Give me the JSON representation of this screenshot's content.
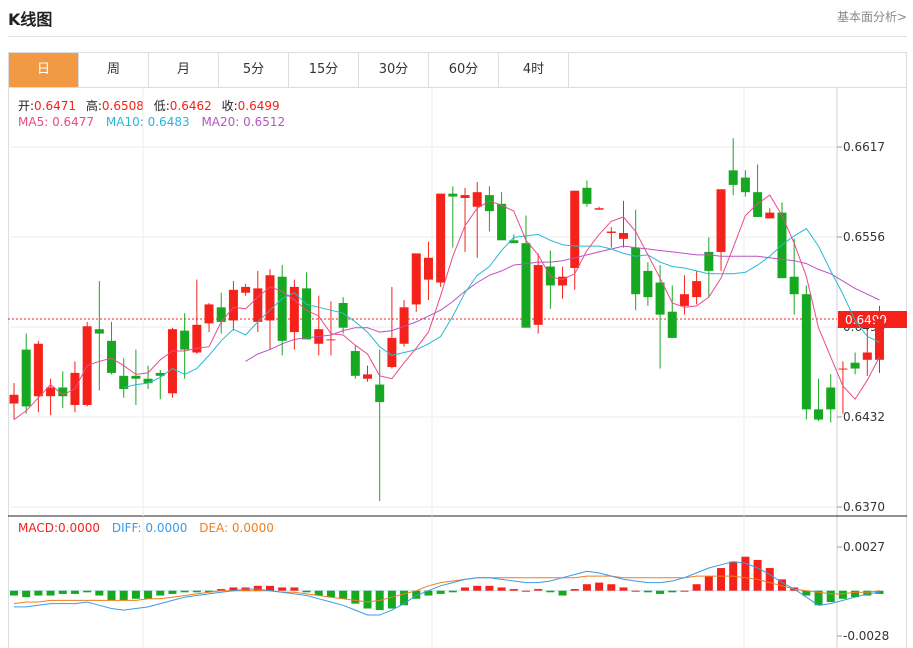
{
  "header": {
    "title": "K线图",
    "link": "基本面分析>"
  },
  "tabs": [
    "日",
    "周",
    "月",
    "5分",
    "15分",
    "30分",
    "60分",
    "4时"
  ],
  "info": {
    "open_label": "开:",
    "open": "0.6471",
    "high_label": "高:",
    "high": "0.6508",
    "low_label": "低:",
    "low": "0.6462",
    "close_label": "收:",
    "close": "0.6499",
    "ma5_label": "MA5:",
    "ma5": "0.6477",
    "ma10_label": "MA10:",
    "ma10": "0.6483",
    "ma20_label": "MA20:",
    "ma20": "0.6512"
  },
  "macd_info": {
    "macd_label": "MACD:",
    "macd": "0.0000",
    "diff_label": "DIFF:",
    "diff": "0.0000",
    "dea_label": "DEA:",
    "dea": "0.0000"
  },
  "colors": {
    "up": "#f5221b",
    "down": "#17a821",
    "ma5": "#e94b8a",
    "ma10": "#27b9d4",
    "ma20": "#b853c4",
    "dea": "#f07f1c",
    "diff": "#3b9ae8",
    "accent": "#f29945"
  },
  "chart_data": [
    {
      "type": "candlestick",
      "title": "",
      "y_ticks": [
        "0.6617",
        "0.6556",
        "0.6494",
        "0.6432",
        "0.6370"
      ],
      "ylim": [
        0.637,
        0.6617
      ],
      "current_price_label": "0.6499",
      "current_price": 0.6499,
      "grid": true,
      "candles": [
        [
          0.6441,
          0.6455,
          0.643,
          0.6447
        ],
        [
          0.6478,
          0.6489,
          0.6434,
          0.6439
        ],
        [
          0.6446,
          0.6484,
          0.6435,
          0.6482
        ],
        [
          0.6446,
          0.6458,
          0.6433,
          0.6452
        ],
        [
          0.6452,
          0.6463,
          0.6438,
          0.6446
        ],
        [
          0.644,
          0.647,
          0.6435,
          0.6462
        ],
        [
          0.644,
          0.6497,
          0.6439,
          0.6494
        ],
        [
          0.6492,
          0.6525,
          0.645,
          0.6489
        ],
        [
          0.6484,
          0.6497,
          0.6461,
          0.6462
        ],
        [
          0.646,
          0.6472,
          0.6445,
          0.6451
        ],
        [
          0.646,
          0.6478,
          0.644,
          0.6458
        ],
        [
          0.6458,
          0.6467,
          0.6451,
          0.6455
        ],
        [
          0.6462,
          0.6464,
          0.6444,
          0.646
        ],
        [
          0.6448,
          0.6493,
          0.6445,
          0.6492
        ],
        [
          0.6491,
          0.6503,
          0.6458,
          0.6478
        ],
        [
          0.6476,
          0.6526,
          0.6475,
          0.6495
        ],
        [
          0.6496,
          0.651,
          0.649,
          0.6509
        ],
        [
          0.6507,
          0.6517,
          0.6489,
          0.6497
        ],
        [
          0.6498,
          0.6525,
          0.6491,
          0.6519
        ],
        [
          0.6517,
          0.6523,
          0.6515,
          0.6521
        ],
        [
          0.6497,
          0.6532,
          0.649,
          0.652
        ],
        [
          0.6498,
          0.6533,
          0.6478,
          0.6529
        ],
        [
          0.6528,
          0.6536,
          0.6474,
          0.6484
        ],
        [
          0.649,
          0.6526,
          0.6478,
          0.6521
        ],
        [
          0.652,
          0.6531,
          0.6489,
          0.6485
        ],
        [
          0.6482,
          0.6515,
          0.6474,
          0.6492
        ],
        [
          0.6485,
          0.6511,
          0.6474,
          0.6485
        ],
        [
          0.651,
          0.6514,
          0.6489,
          0.6493
        ],
        [
          0.6477,
          0.6481,
          0.6458,
          0.646
        ],
        [
          0.6458,
          0.6467,
          0.6456,
          0.6461
        ],
        [
          0.6454,
          0.6478,
          0.6374,
          0.6442
        ],
        [
          0.6466,
          0.6521,
          0.6465,
          0.6486
        ],
        [
          0.6482,
          0.6512,
          0.648,
          0.6507
        ],
        [
          0.6509,
          0.6541,
          0.6504,
          0.6544
        ],
        [
          0.6526,
          0.6552,
          0.6512,
          0.6541
        ],
        [
          0.6524,
          0.6583,
          0.6521,
          0.6585
        ],
        [
          0.6585,
          0.659,
          0.6548,
          0.6583
        ],
        [
          0.6582,
          0.6589,
          0.6545,
          0.6584
        ],
        [
          0.6576,
          0.6593,
          0.6541,
          0.6586
        ],
        [
          0.6584,
          0.659,
          0.6559,
          0.6573
        ],
        [
          0.6578,
          0.6586,
          0.6553,
          0.6553
        ],
        [
          0.6553,
          0.6557,
          0.6551,
          0.6551
        ],
        [
          0.6551,
          0.657,
          0.6512,
          0.6493
        ],
        [
          0.6495,
          0.6544,
          0.6489,
          0.6536
        ],
        [
          0.6535,
          0.6546,
          0.6506,
          0.6522
        ],
        [
          0.6522,
          0.6535,
          0.6513,
          0.6528
        ],
        [
          0.6534,
          0.6587,
          0.6519,
          0.6587
        ],
        [
          0.6589,
          0.6594,
          0.6576,
          0.6578
        ],
        [
          0.6574,
          0.6576,
          0.6574,
          0.6575
        ],
        [
          0.6558,
          0.6562,
          0.6548,
          0.6559
        ],
        [
          0.6554,
          0.658,
          0.6548,
          0.6558
        ],
        [
          0.6548,
          0.6574,
          0.6505,
          0.6516
        ],
        [
          0.6532,
          0.6538,
          0.6508,
          0.6514
        ],
        [
          0.6524,
          0.6536,
          0.6465,
          0.6502
        ],
        [
          0.6504,
          0.6522,
          0.6497,
          0.6486
        ],
        [
          0.6508,
          0.6529,
          0.6502,
          0.6516
        ],
        [
          0.6514,
          0.6532,
          0.6509,
          0.6525
        ],
        [
          0.6545,
          0.6555,
          0.6514,
          0.6532
        ],
        [
          0.6545,
          0.6582,
          0.6532,
          0.6588
        ],
        [
          0.6601,
          0.6623,
          0.6584,
          0.6591
        ],
        [
          0.6596,
          0.6601,
          0.6583,
          0.6586
        ],
        [
          0.6586,
          0.6605,
          0.6569,
          0.6569
        ],
        [
          0.6568,
          0.6575,
          0.6568,
          0.6572
        ],
        [
          0.6572,
          0.6579,
          0.6555,
          0.6527
        ],
        [
          0.6528,
          0.6554,
          0.6502,
          0.6516
        ],
        [
          0.6516,
          0.6522,
          0.643,
          0.6437
        ],
        [
          0.6437,
          0.6458,
          0.6429,
          0.643
        ],
        [
          0.6452,
          0.6461,
          0.6428,
          0.6437
        ],
        [
          0.6465,
          0.647,
          0.6434,
          0.6465
        ],
        [
          0.6469,
          0.6476,
          0.6461,
          0.6465
        ],
        [
          0.6471,
          0.6491,
          0.646,
          0.6476
        ],
        [
          0.6471,
          0.6508,
          0.6462,
          0.6499
        ]
      ],
      "ma5": [
        0.643,
        0.6436,
        0.6445,
        0.6454,
        0.6447,
        0.6451,
        0.6467,
        0.647,
        0.6472,
        0.6467,
        0.6461,
        0.6462,
        0.6471,
        0.6477,
        0.6477,
        0.6479,
        0.648,
        0.6497,
        0.6507,
        0.6506,
        0.6514,
        0.6521,
        0.6518,
        0.6512,
        0.6505,
        0.6501,
        0.6489,
        0.6488,
        0.6481,
        0.6475,
        0.646,
        0.6458,
        0.6469,
        0.6479,
        0.649,
        0.6515,
        0.6542,
        0.6563,
        0.6575,
        0.658,
        0.6577,
        0.6573,
        0.6553,
        0.6543,
        0.6528,
        0.6526,
        0.653,
        0.6546,
        0.6557,
        0.6566,
        0.6569,
        0.6559,
        0.6543,
        0.6527,
        0.651,
        0.6507,
        0.6508,
        0.6514,
        0.6527,
        0.6548,
        0.657,
        0.6578,
        0.6584,
        0.657,
        0.6551,
        0.6528,
        0.6493,
        0.6473,
        0.6453,
        0.6444,
        0.6457,
        0.6473
      ],
      "ma10": [
        null,
        null,
        null,
        null,
        null,
        null,
        null,
        null,
        null,
        0.6452,
        0.6454,
        0.6455,
        0.6459,
        0.6465,
        0.6461,
        0.6465,
        0.6474,
        0.6484,
        0.6492,
        0.6488,
        0.6497,
        0.6505,
        0.6513,
        0.6517,
        0.6509,
        0.6507,
        0.6505,
        0.6503,
        0.6497,
        0.649,
        0.648,
        0.6474,
        0.6476,
        0.6478,
        0.6482,
        0.6487,
        0.6501,
        0.6517,
        0.6529,
        0.6535,
        0.6546,
        0.6555,
        0.6556,
        0.6557,
        0.6553,
        0.655,
        0.6549,
        0.6549,
        0.6549,
        0.6547,
        0.6544,
        0.6542,
        0.6543,
        0.6538,
        0.6535,
        0.6534,
        0.6532,
        0.653,
        0.653,
        0.653,
        0.6531,
        0.6536,
        0.6542,
        0.655,
        0.6556,
        0.6561,
        0.6549,
        0.6532,
        0.6516,
        0.6498,
        0.6487,
        0.6483
      ],
      "ma20": [
        null,
        null,
        null,
        null,
        null,
        null,
        null,
        null,
        null,
        null,
        null,
        null,
        null,
        null,
        null,
        null,
        null,
        null,
        null,
        0.647,
        0.6475,
        0.6478,
        0.6482,
        0.6485,
        0.6486,
        0.6487,
        0.6488,
        0.6491,
        0.6493,
        0.6493,
        0.649,
        0.6491,
        0.6494,
        0.6497,
        0.6501,
        0.6505,
        0.6511,
        0.6518,
        0.6524,
        0.6529,
        0.6532,
        0.6536,
        0.6537,
        0.6538,
        0.6538,
        0.6539,
        0.6541,
        0.6543,
        0.6545,
        0.6547,
        0.6549,
        0.6548,
        0.6547,
        0.6546,
        0.6545,
        0.6544,
        0.6543,
        0.6543,
        0.6542,
        0.6542,
        0.6542,
        0.6542,
        0.6541,
        0.654,
        0.6539,
        0.6537,
        0.6533,
        0.653,
        0.6525,
        0.652,
        0.6516,
        0.6512
      ]
    },
    {
      "type": "bar",
      "title": "MACD",
      "y_ticks": [
        "0.0027",
        "-0.0028"
      ],
      "ylim": [
        -0.0028,
        0.0027
      ],
      "macd": [
        -0.0003,
        -0.0004,
        -0.0003,
        -0.0003,
        -0.0002,
        -0.0002,
        -0.0001,
        -0.0003,
        -0.0006,
        -0.0006,
        -0.0005,
        -0.0005,
        -0.0003,
        -0.0002,
        -0.0001,
        -0.0001,
        -0.0001,
        0.0001,
        0.0002,
        0.0002,
        0.0003,
        0.0003,
        0.0002,
        0.0002,
        -0.0001,
        -0.0003,
        -0.0004,
        -0.0005,
        -0.0008,
        -0.0011,
        -0.0012,
        -0.0011,
        -0.0009,
        -0.0005,
        -0.0003,
        -0.0002,
        -0.0001,
        0.0002,
        0.0003,
        0.0003,
        0.0002,
        0.0001,
        0.0,
        0.0001,
        -0.0001,
        -0.0003,
        0.0001,
        0.0004,
        0.0005,
        0.0004,
        0.0002,
        0.0,
        -0.0001,
        -0.0002,
        -0.0001,
        0.0,
        0.0004,
        0.0009,
        0.0014,
        0.0018,
        0.0021,
        0.0019,
        0.0014,
        0.0007,
        0.0002,
        -0.0003,
        -0.0009,
        -0.0007,
        -0.0005,
        -0.0004,
        -0.0003,
        -0.0002
      ],
      "diff": [
        -0.001,
        -0.001,
        -0.0009,
        -0.0008,
        -0.0008,
        -0.0008,
        -0.0007,
        -0.0009,
        -0.0011,
        -0.0012,
        -0.0011,
        -0.001,
        -0.0008,
        -0.0006,
        -0.0004,
        -0.0003,
        -0.0002,
        -0.0001,
        0.0,
        0.0001,
        0.0001,
        0.0,
        -0.0001,
        -0.0002,
        -0.0003,
        -0.0005,
        -0.0007,
        -0.0009,
        -0.0012,
        -0.0015,
        -0.0015,
        -0.0012,
        -0.0008,
        -0.0003,
        0.0,
        0.0003,
        0.0005,
        0.0007,
        0.0008,
        0.0008,
        0.0007,
        0.0006,
        0.0005,
        0.0005,
        0.0006,
        0.0008,
        0.001,
        0.0012,
        0.0011,
        0.0009,
        0.0007,
        0.0006,
        0.0005,
        0.0005,
        0.0006,
        0.0008,
        0.0011,
        0.0014,
        0.0016,
        0.0018,
        0.0017,
        0.0014,
        0.001,
        0.0005,
        0.0001,
        -0.0004,
        -0.0009,
        -0.0008,
        -0.0006,
        -0.0004,
        -0.0002,
        -0.0001
      ],
      "dea": [
        -0.0008,
        -0.0007,
        -0.0007,
        -0.0006,
        -0.0006,
        -0.0006,
        -0.0006,
        -0.0006,
        -0.0006,
        -0.0006,
        -0.0006,
        -0.0005,
        -0.0005,
        -0.0004,
        -0.0003,
        -0.0002,
        -0.0001,
        0.0,
        0.0,
        0.0,
        0.0,
        0.0,
        -0.0001,
        -0.0001,
        -0.0002,
        -0.0003,
        -0.0004,
        -0.0005,
        -0.0006,
        -0.0007,
        -0.0006,
        -0.0004,
        -0.0002,
        0.0,
        0.0003,
        0.0005,
        0.0006,
        0.0007,
        0.0008,
        0.0008,
        0.0008,
        0.0008,
        0.0008,
        0.0008,
        0.0008,
        0.0008,
        0.0008,
        0.0009,
        0.0009,
        0.0009,
        0.0008,
        0.0008,
        0.0008,
        0.0008,
        0.0008,
        0.0008,
        0.0009,
        0.0009,
        0.0009,
        0.0009,
        0.0008,
        0.0007,
        0.0005,
        0.0003,
        0.0001,
        0.0,
        -0.0001,
        -0.0002,
        -0.0002,
        -0.0001,
        -0.0001,
        0.0
      ]
    }
  ]
}
